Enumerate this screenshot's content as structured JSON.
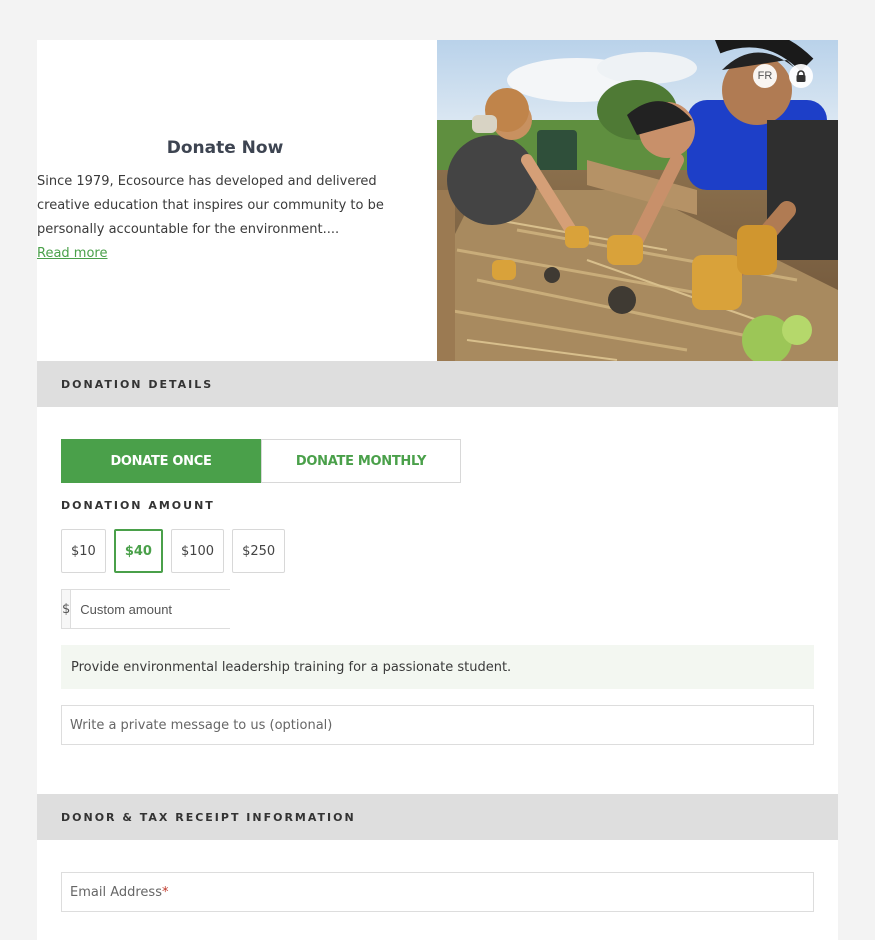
{
  "intro": {
    "title": "Donate Now",
    "description": "Since 1979, Ecosource has developed and delivered creative education that inspires our community to be personally accountable for the environment....",
    "read_more": "Read more"
  },
  "header_buttons": {
    "language": "FR",
    "lock_icon": "lock-icon"
  },
  "donation_details": {
    "heading": "DONATION DETAILS",
    "toggle": {
      "once": "DONATE ONCE",
      "monthly": "DONATE MONTHLY",
      "selected": "once"
    },
    "amount_label": "DONATION AMOUNT",
    "amounts": [
      "$10",
      "$40",
      "$100",
      "$250"
    ],
    "selected_amount": "$40",
    "currency_symbol": "$",
    "custom_placeholder": "Custom amount",
    "impact_text": "Provide environmental leadership training for a passionate student.",
    "message_placeholder": "Write a private message to us (optional)"
  },
  "donor": {
    "heading": "DONOR & TAX RECEIPT INFORMATION",
    "email_label": "Email Address",
    "required_mark": "*"
  },
  "colors": {
    "accent": "#4aa04a",
    "section_bg": "#dedede",
    "page_bg": "#f3f3f3",
    "impact_bg": "#f3f7f1"
  }
}
